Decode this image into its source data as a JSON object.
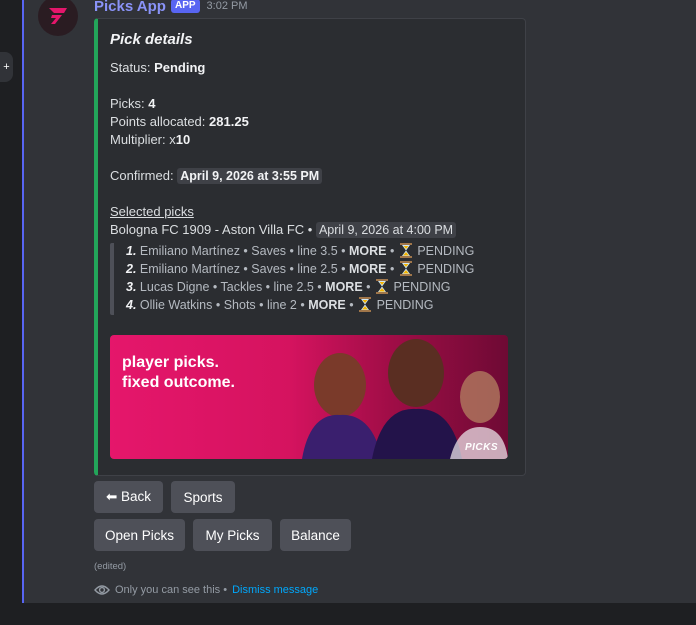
{
  "message": {
    "author": "Picks App",
    "badge": "APP",
    "timestamp": "3:02 PM"
  },
  "embed": {
    "title": "Pick details",
    "status_label": "Status:",
    "status_value": "Pending",
    "picks_label": "Picks:",
    "picks_value": "4",
    "points_label": "Points allocated:",
    "points_value": "281.25",
    "multiplier_label": "Multiplier: x",
    "multiplier_value": "10",
    "confirmed_label": "Confirmed:",
    "confirmed_value": "April 9, 2026 at 3:55 PM",
    "selected_picks_label": "Selected picks",
    "match": "Bologna FC 1909 - Aston Villa FC",
    "match_sep": "•",
    "match_time": "April 9, 2026 at 4:00 PM",
    "picks": [
      {
        "num": "1.",
        "text": "Emiliano Martínez • Saves • line 3.5 •",
        "direction": "MORE",
        "sep": "•",
        "status": "PENDING"
      },
      {
        "num": "2.",
        "text": "Emiliano Martínez • Saves • line 2.5 •",
        "direction": "MORE",
        "sep": "•",
        "status": "PENDING"
      },
      {
        "num": "3.",
        "text": "Lucas Digne • Tackles • line 2.5 •",
        "direction": "MORE",
        "sep": "•",
        "status": "PENDING"
      },
      {
        "num": "4.",
        "text": "Ollie Watkins • Shots • line 2 •",
        "direction": "MORE",
        "sep": "•",
        "status": "PENDING"
      }
    ],
    "banner": {
      "line1": "player picks.",
      "line2": "fixed outcome.",
      "logo": "PICKS"
    }
  },
  "buttons": {
    "back": "⬅ Back",
    "sports": "Sports",
    "open_picks": "Open Picks",
    "my_picks": "My Picks",
    "balance": "Balance"
  },
  "edited": "(edited)",
  "ephemeral": {
    "text": "Only you can see this •",
    "dismiss": "Dismiss message"
  },
  "colors": {
    "embed_accent": "#23a55a",
    "author": "#8a93f8",
    "app_badge": "#5865f2",
    "link": "#00a8fc",
    "banner": "#e5166b"
  }
}
